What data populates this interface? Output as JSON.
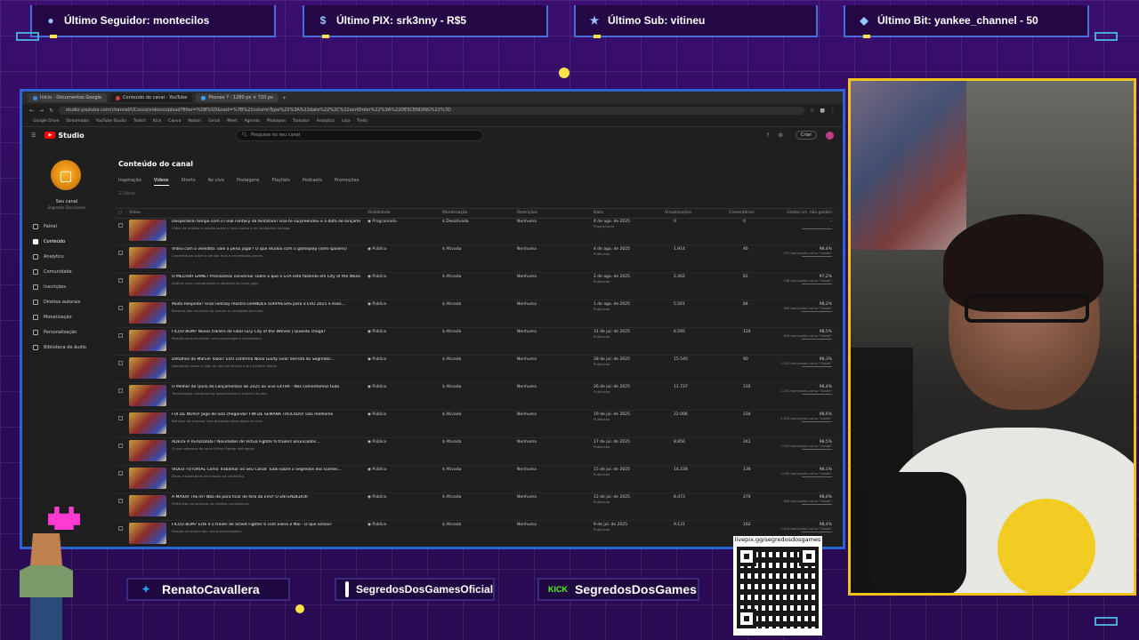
{
  "alerts": [
    {
      "label": "Último Seguidor: montecilos",
      "icon": "user-icon"
    },
    {
      "label": "Último PIX: srk3nny - R$5",
      "icon": "dollar-icon"
    },
    {
      "label": "Último Sub: vitineu",
      "icon": "star-icon"
    },
    {
      "label": "Último Bit: yankee_channel - 50",
      "icon": "diamond-icon"
    }
  ],
  "browser": {
    "tabs": [
      "Início - Documentos Google",
      "Conteúdo do canal - YouTube",
      "Phonex ? - 1280 px × 720 px"
    ],
    "url": "studio.youtube.com/channel/UCxxxx/videos/upload?filter=%5B%5D&sort=%7B%22columnType%22%3A%22date%22%2C%22sortOrder%22%3A%22DESCENDING%22%7D",
    "bookmarks": [
      "Google Drive",
      "Streamlabs",
      "YouTube Studio",
      "Twitch",
      "Kick",
      "Canva",
      "Notion",
      "Gmail",
      "Meet",
      "Agenda",
      "Photopea",
      "Tradutor",
      "Analytics",
      "Loja",
      "Trello"
    ]
  },
  "studio": {
    "logo": "Studio",
    "search_placeholder": "Pesquise no seu canal",
    "create_label": "Criar",
    "channel_name": "Seu canal",
    "channel_sub": "Segredos Dos Games",
    "sidebar": [
      "Painel",
      "Conteúdo",
      "Analytics",
      "Comunidade",
      "Inscrições",
      "Direitos autorais",
      "Monetização",
      "Personalização",
      "Biblioteca de áudio"
    ],
    "page_title": "Conteúdo do canal",
    "tabs": [
      "Inspiração",
      "Vídeos",
      "Shorts",
      "Ao vivo",
      "Postagens",
      "Playlists",
      "Podcasts",
      "Promoções"
    ],
    "filter_label": "Filtrar",
    "columns": [
      "Vídeo",
      "Visibilidade",
      "Monetização",
      "Restrições",
      "Data",
      "Visualizações",
      "Comentários",
      "Gostei (vs. não gostei)"
    ],
    "rows": [
      {
        "title": "Desperdicei tempo com o Final Fantasy da tentativa? Isso te surpreendeu e a data de lançamento...",
        "desc": "Vídeo de análise e reação sobre o novo trailer e as novidades do jogo.",
        "vis": "Programado",
        "mon": "Desativada",
        "res": "Nenhuma",
        "date": "4 de ago. de 2025",
        "date_sub": "Programado",
        "views": "0",
        "comments": "0",
        "likes": "–",
        "likes_sub": ""
      },
      {
        "title": "Vídeo com o veredito: vale a pena jogar? O que mudou com o gameplay (sem spoilers)",
        "desc": "Comentários sobre a versão final e impressões gerais.",
        "vis": "Público",
        "mon": "Ativada",
        "res": "Nenhuma",
        "date": "4 de ago. de 2025",
        "date_sub": "Publicado",
        "views": "1.914",
        "comments": "46",
        "likes": "98,4%",
        "likes_sub": "139 marcações como \"Gostei\""
      },
      {
        "title": "O MELHOR GAME? Precisamos conversar sobre o que o GTA está fazendo em City of the Wolves",
        "desc": "Análise com comparações e detalhes do novo jogo.",
        "vis": "Público",
        "mon": "Ativada",
        "res": "Nenhuma",
        "date": "2 de ago. de 2025",
        "date_sub": "Publicado",
        "views": "2.402",
        "comments": "81",
        "likes": "97,2%",
        "likes_sub": "138 marcações como \"Gostei\""
      },
      {
        "title": "Muito Respeito! Final Fantasy mostra GRANDES SURPRESAS para o EVO 2025 e mais...",
        "desc": "Resumo dos anúncios do evento e novidades de lutas.",
        "vis": "Público",
        "mon": "Ativada",
        "res": "Nenhuma",
        "date": "1 de ago. de 2025",
        "date_sub": "Publicado",
        "views": "5.501",
        "comments": "84",
        "likes": "98,2%",
        "likes_sub": "306 marcações como \"Gostei\""
      },
      {
        "title": "FICOU BOM? Novos trailers de Fatal Fury City of the Wolves | Quando chega?",
        "desc": "Reação ao novo trailer com personagens convidados.",
        "vis": "Público",
        "mon": "Ativada",
        "res": "Nenhuma",
        "date": "31 de jul. de 2025",
        "date_sub": "Publicado",
        "views": "6.595",
        "comments": "124",
        "likes": "98,5%",
        "likes_sub": "634 marcações como \"Gostei\""
      },
      {
        "title": "Detalhes do Marvel Tokon: EVO confirma Novo Guilty Gear derrota do Segredos...",
        "desc": "Novidades sobre o jogo de luta da Marvel e Arc System Works.",
        "vis": "Público",
        "mon": "Ativada",
        "res": "Nenhuma",
        "date": "28 de jul. de 2025",
        "date_sub": "Publicado",
        "views": "15.540",
        "comments": "90",
        "likes": "98,3%",
        "likes_sub": "1.022 marcações como \"Gostei\""
      },
      {
        "title": "O Melhor do Quilo de Lançamentos de 2025 ao vivo EXTRA - Nós comentamos tudo",
        "desc": "Transmissão comentando lançamentos e trailers do ano.",
        "vis": "Público",
        "mon": "Ativada",
        "res": "Nenhuma",
        "date": "26 de jul. de 2025",
        "date_sub": "Publicado",
        "views": "11.737",
        "comments": "216",
        "likes": "98,4%",
        "likes_sub": "1.301 marcações como \"Gostei\""
      },
      {
        "title": "FOI DE NOVO! Jogo de luta chegando! FIM DE SEMANA TROCADO! Dos melhores",
        "desc": "Notícias da semana com destaque para jogos de luta.",
        "vis": "Público",
        "mon": "Ativada",
        "res": "Nenhuma",
        "date": "19 de jul. de 2025",
        "date_sub": "Publicado",
        "views": "22.006",
        "comments": "234",
        "likes": "98,6%",
        "likes_sub": "2.028 marcações como \"Gostei\""
      },
      {
        "title": "ADEUS A REALIDADE? Novidades de Virtua Fighter 6 trailers anunciados...",
        "desc": "O que sabemos do novo Virtua Fighter até agora.",
        "vis": "Público",
        "mon": "Ativada",
        "res": "Nenhuma",
        "date": "17 de jul. de 2025",
        "date_sub": "Publicado",
        "views": "8.856",
        "comments": "242",
        "likes": "98,5%",
        "likes_sub": "1.034 marcações como \"Gostei\""
      },
      {
        "title": "VIDEO TUTORIAL Como Trabalhar no Seu Canal: Tudo sobre o Segredos dos Games...",
        "desc": "Dicas e bastidores da criação de conteúdo.",
        "vis": "Público",
        "mon": "Ativada",
        "res": "Nenhuma",
        "date": "15 de jul. de 2025",
        "date_sub": "Publicado",
        "views": "14.228",
        "comments": "136",
        "likes": "98,1%",
        "likes_sub": "1.196 marcações como \"Gostei\""
      },
      {
        "title": "A MAIOR TRETA? Não dá para ficar de fora da EVO! O ENTENDEDOR",
        "desc": "Polêmicas da semana no cenário competitivo.",
        "vis": "Público",
        "mon": "Ativada",
        "res": "Nenhuma",
        "date": "12 de jul. de 2025",
        "date_sub": "Publicado",
        "views": "8.473",
        "comments": "274",
        "likes": "98,0%",
        "likes_sub": "806 marcações como \"Gostei\""
      },
      {
        "title": "FICOU BOM? Este é o trailer de Street Fighter 6 com Elena e Mai - O que achou?",
        "desc": "Reação ao trailer dos novos personagens.",
        "vis": "Público",
        "mon": "Ativada",
        "res": "Nenhuma",
        "date": "9 de jul. de 2025",
        "date_sub": "Publicado",
        "views": "9.131",
        "comments": "162",
        "likes": "98,4%",
        "likes_sub": "1.018 marcações como \"Gostei\""
      }
    ]
  },
  "social": {
    "twitter": "RenatoCavallera",
    "instagram": "SegredosDosGamesOficial",
    "kick_badge": "KICK",
    "kick": "SegredosDosGames",
    "qr_url": "livepix.gg/segredosdosgames"
  },
  "colors": {
    "accent_border": "#2e63d8",
    "cam_border": "#f2c41a",
    "kick": "#53fc18"
  }
}
